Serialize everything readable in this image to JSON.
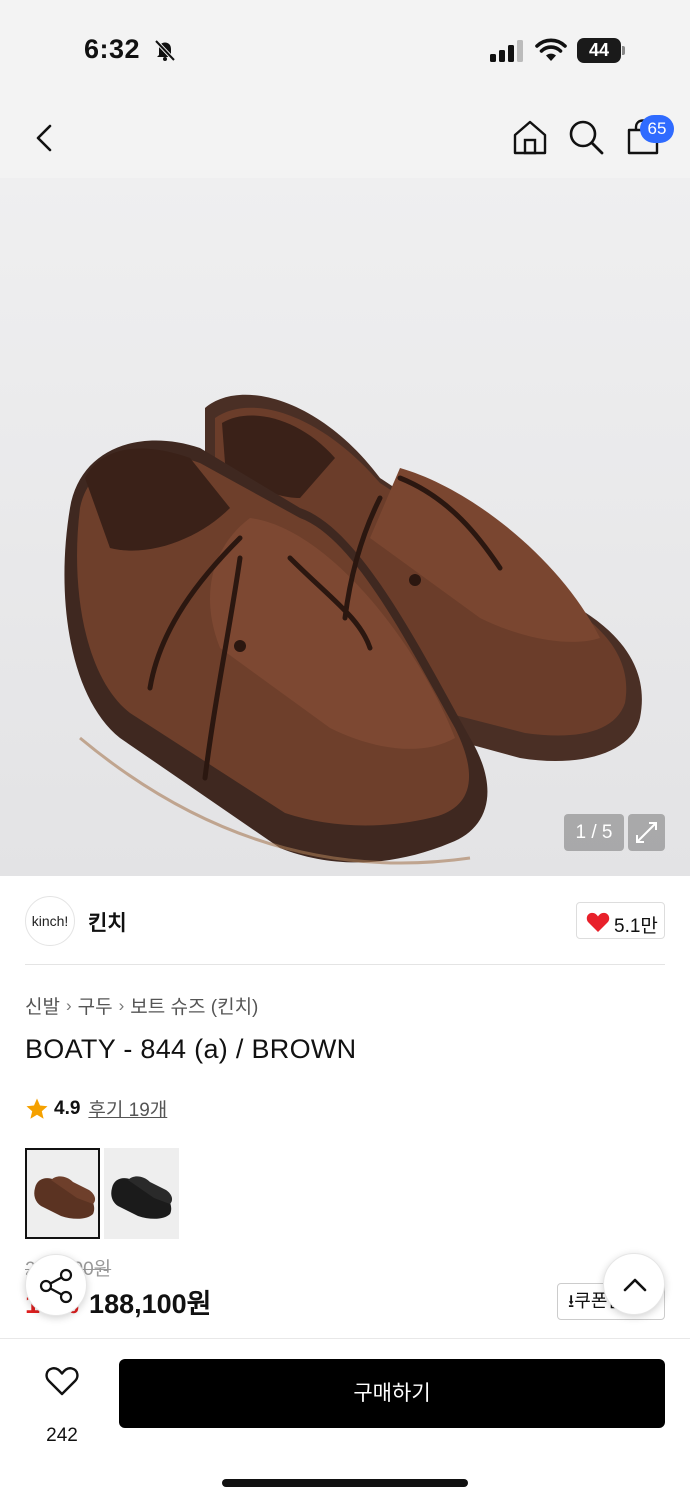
{
  "status_bar": {
    "time": "6:32",
    "battery": "44"
  },
  "nav": {
    "cart_count": "65"
  },
  "gallery": {
    "counter": "1 / 5"
  },
  "brand": {
    "logo_text": "kinch!",
    "name": "킨치",
    "likes": "5.1만"
  },
  "breadcrumb": [
    "신발",
    "구두",
    "보트 슈즈 (킨치)"
  ],
  "product": {
    "title": "BOATY - 844 (a) / BROWN",
    "rating": "4.9",
    "reviews": "후기 19개",
    "original_price": "209,000원",
    "discount": "10%",
    "price": "188,100원",
    "coupon_label": "⭳쿠폰받기"
  },
  "bottom": {
    "wish_count": "242",
    "buy_label": "구매하기"
  },
  "colors": {
    "accent_blue": "#2f6bff",
    "heart_red": "#e8202a",
    "star": "#f5a100",
    "discount_red": "#e02020"
  }
}
